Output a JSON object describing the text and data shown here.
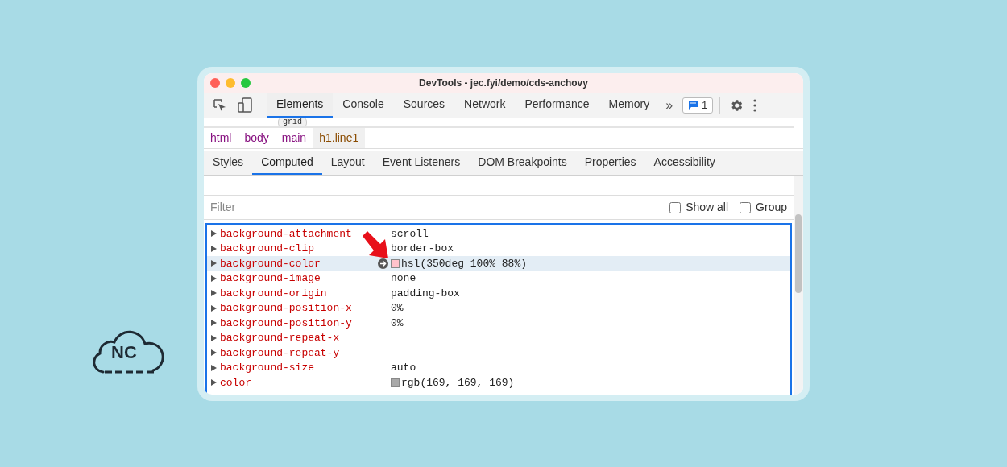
{
  "window": {
    "title": "DevTools - jec.fyi/demo/cds-anchovy"
  },
  "main_tabs": [
    {
      "label": "Elements",
      "selected": true
    },
    {
      "label": "Console",
      "selected": false
    },
    {
      "label": "Sources",
      "selected": false
    },
    {
      "label": "Network",
      "selected": false
    },
    {
      "label": "Performance",
      "selected": false
    },
    {
      "label": "Memory",
      "selected": false
    }
  ],
  "more_tabs": "»",
  "issues_count": "1",
  "dom_badge": "grid",
  "breadcrumbs": [
    {
      "label": "html",
      "selected": false
    },
    {
      "label": "body",
      "selected": false
    },
    {
      "label": "main",
      "selected": false
    },
    {
      "label": "h1.line1",
      "selected": true
    }
  ],
  "sub_tabs": [
    {
      "label": "Styles",
      "selected": false
    },
    {
      "label": "Computed",
      "selected": true
    },
    {
      "label": "Layout",
      "selected": false
    },
    {
      "label": "Event Listeners",
      "selected": false
    },
    {
      "label": "DOM Breakpoints",
      "selected": false
    },
    {
      "label": "Properties",
      "selected": false
    },
    {
      "label": "Accessibility",
      "selected": false
    }
  ],
  "filter": {
    "placeholder": "Filter"
  },
  "options": [
    {
      "label": "Show all",
      "checked": false
    },
    {
      "label": "Group",
      "checked": false
    }
  ],
  "properties": [
    {
      "name": "background-attachment",
      "value": "scroll",
      "selected": false
    },
    {
      "name": "background-clip",
      "value": "border-box",
      "selected": false
    },
    {
      "name": "background-color",
      "value": "hsl(350deg 100% 88%)",
      "color": "#ffc2cb",
      "selected": true
    },
    {
      "name": "background-image",
      "value": "none",
      "selected": false
    },
    {
      "name": "background-origin",
      "value": "padding-box",
      "selected": false
    },
    {
      "name": "background-position-x",
      "value": "0%",
      "selected": false
    },
    {
      "name": "background-position-y",
      "value": "0%",
      "selected": false
    },
    {
      "name": "background-repeat-x",
      "selected": false
    },
    {
      "name": "background-repeat-y",
      "selected": false
    },
    {
      "name": "background-size",
      "value": "auto",
      "selected": false
    },
    {
      "name": "color",
      "value": "rgb(169, 169, 169)",
      "color": "#a9a9a9",
      "selected": false
    }
  ],
  "logo": {
    "text": "NC"
  }
}
